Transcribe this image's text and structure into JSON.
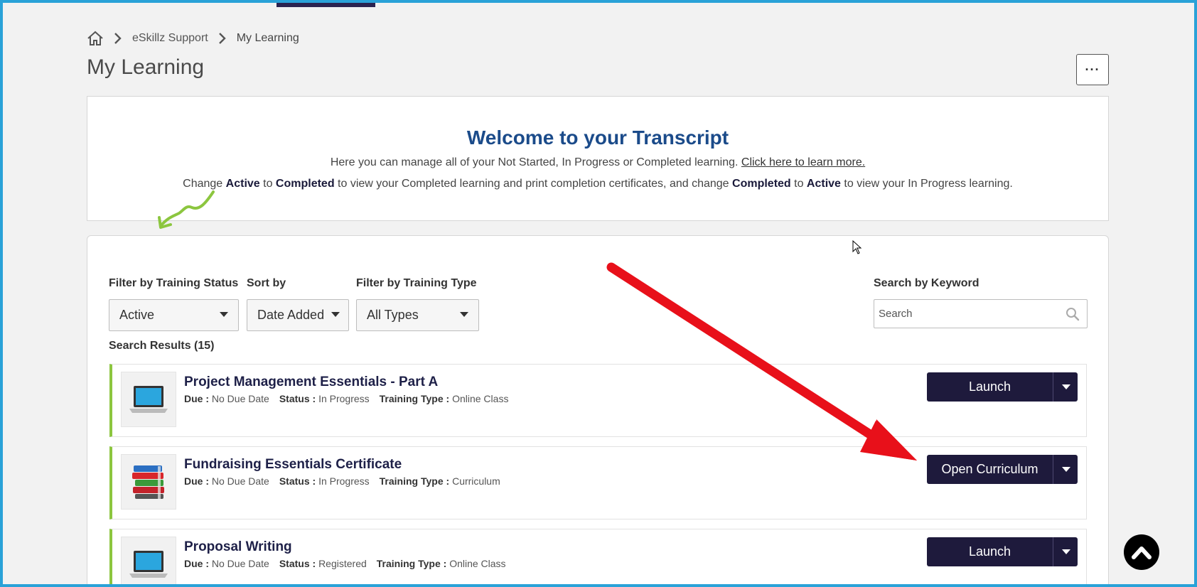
{
  "breadcrumb": {
    "home_icon": "home-icon",
    "items": [
      "eSkillz Support",
      "My Learning"
    ]
  },
  "page": {
    "title": "My Learning",
    "more_button_label": "···"
  },
  "welcome": {
    "title": "Welcome to your Transcript",
    "line1_text": "Here you can manage all of your Not Started, In Progress or Completed learning. ",
    "line1_link": "Click here to learn more.",
    "line2": {
      "t1": "Change ",
      "b1": "Active",
      "t2": " to ",
      "b2": "Completed",
      "t3": " to view your Completed learning and print completion certificates, and change ",
      "b3": "Completed",
      "t4": " to ",
      "b4": "Active",
      "t5": " to view your In Progress learning."
    }
  },
  "filters": {
    "status_label": "Filter by Training Status",
    "status_value": "Active",
    "sort_label": "Sort by",
    "sort_value": "Date Added",
    "type_label": "Filter by Training Type",
    "type_value": "All Types",
    "keyword_label": "Search by Keyword",
    "keyword_placeholder": "Search"
  },
  "results": {
    "count_text": "Search Results (15)",
    "items": [
      {
        "title": "Project Management Essentials - Part A",
        "due_label": "Due :",
        "due_value": "No Due Date",
        "status_label": "Status :",
        "status_value": "In Progress",
        "type_label": "Training Type :",
        "type_value": "Online Class",
        "action_label": "Launch",
        "thumbnail": "laptop-icon"
      },
      {
        "title": "Fundraising Essentials Certificate",
        "due_label": "Due :",
        "due_value": "No Due Date",
        "status_label": "Status :",
        "status_value": "In Progress",
        "type_label": "Training Type :",
        "type_value": "Curriculum",
        "action_label": "Open Curriculum",
        "thumbnail": "books-icon"
      },
      {
        "title": "Proposal Writing",
        "due_label": "Due :",
        "due_value": "No Due Date",
        "status_label": "Status :",
        "status_value": "Registered",
        "type_label": "Training Type :",
        "type_value": "Online Class",
        "action_label": "Launch",
        "thumbnail": "laptop-icon"
      }
    ]
  },
  "colors": {
    "frame": "#2aa2d8",
    "title_blue": "#1b4b8a",
    "button_navy": "#1e1a3c",
    "card_accent": "#8cc63f",
    "annotation_red": "#e8101a",
    "annotation_green": "#8cc63f"
  }
}
